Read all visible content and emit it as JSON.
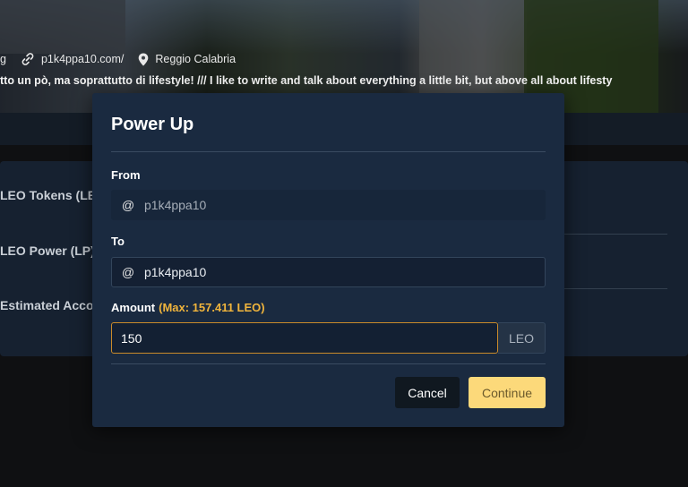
{
  "profile": {
    "meta_prefix": "g",
    "website": "p1k4ppa10.com/",
    "location": "Reggio Calabria",
    "bio": "tto un pò, ma soprattutto di lifestyle! /// I like to write and talk about everything a little bit, but above all about lifesty"
  },
  "wallet_rows": [
    "LEO Tokens (LEO",
    "LEO Power (LP)",
    "Estimated Accou"
  ],
  "modal": {
    "title": "Power Up",
    "from_label": "From",
    "from_value": "p1k4ppa10",
    "to_label": "To",
    "to_value": "p1k4ppa10",
    "at_symbol": "@",
    "amount_label": "Amount",
    "amount_max": "(Max: 157.411 LEO)",
    "amount_value": "150",
    "unit": "LEO",
    "cancel_label": "Cancel",
    "continue_label": "Continue"
  },
  "icons": [
    "link-icon",
    "location-pin-icon"
  ],
  "colors": {
    "modal_bg": "#1a2a40",
    "accent_orange": "#f0b43c",
    "continue_bg": "#fcd97a",
    "cancel_bg": "#101820"
  }
}
